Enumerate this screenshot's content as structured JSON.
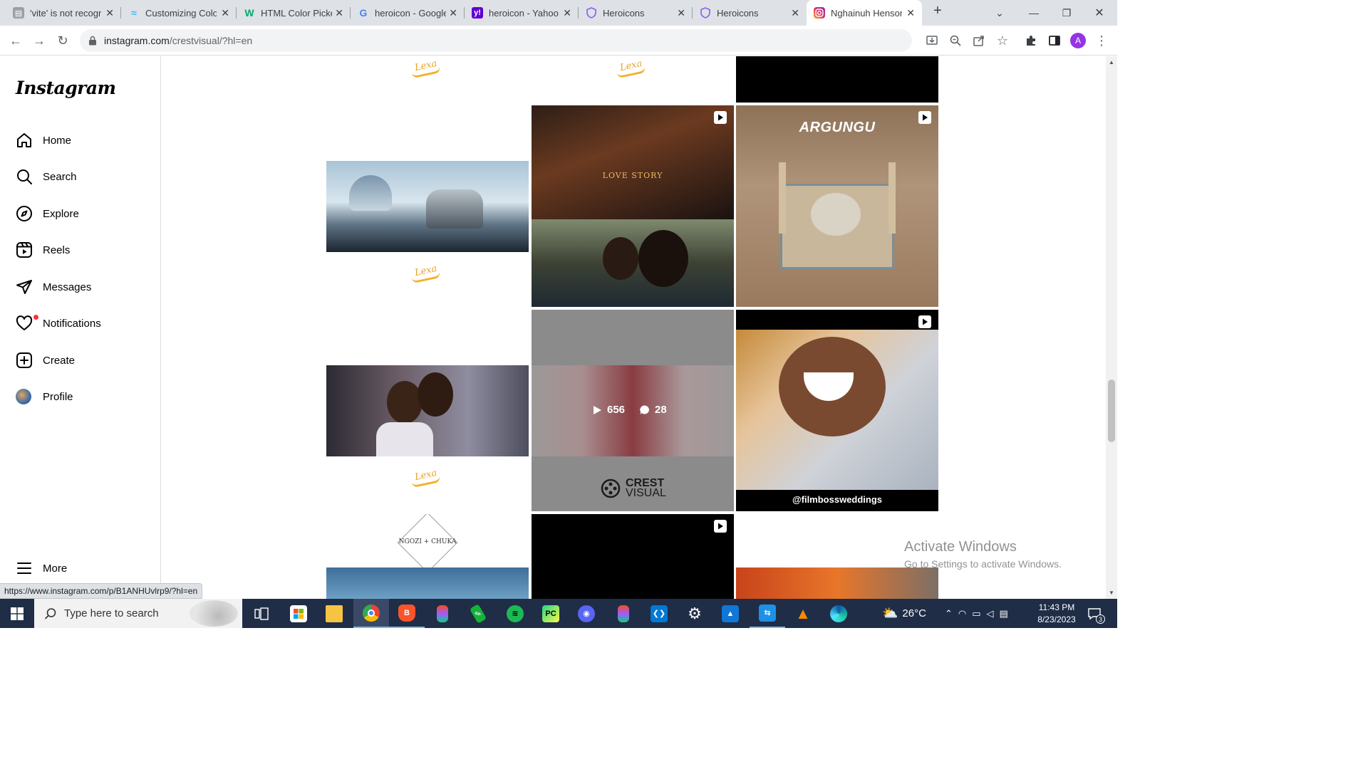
{
  "browser": {
    "tabs": [
      {
        "title": "'vite' is not recognized",
        "favicon": "page-icon",
        "color": "#5f6368"
      },
      {
        "title": "Customizing Colors",
        "favicon": "tailwind-icon",
        "color": "#38bdf8"
      },
      {
        "title": "HTML Color Picker",
        "favicon": "w3schools-icon",
        "color": "#04aa6d"
      },
      {
        "title": "heroicon - Google Search",
        "favicon": "google-icon",
        "color": "#4285f4"
      },
      {
        "title": "heroicon - Yahoo Search",
        "favicon": "yahoo-icon",
        "color": "#6001d2"
      },
      {
        "title": "Heroicons",
        "favicon": "heroicons-icon",
        "color": "#8b5cf6"
      },
      {
        "title": "Heroicons",
        "favicon": "heroicons-icon",
        "color": "#8b5cf6"
      },
      {
        "title": "Nghainuh Henson",
        "favicon": "instagram-icon",
        "color": "#e1306c"
      }
    ],
    "url_host": "instagram.com",
    "url_path": "/crestvisual/?hl=en",
    "profile_initial": "A",
    "status_url": "https://www.instagram.com/p/B1ANHUvlrp9/?hl=en"
  },
  "instagram": {
    "logo": "Instagram",
    "nav": {
      "home": "Home",
      "search": "Search",
      "explore": "Explore",
      "reels": "Reels",
      "messages": "Messages",
      "notifications": "Notifications",
      "create": "Create",
      "profile": "Profile",
      "more": "More"
    },
    "posts": {
      "logo_text": "Lexa Imagery",
      "love_story": "LOVE STORY",
      "argungu": "ARGUNGU",
      "hover_plays": "656",
      "hover_comments": "28",
      "crest_line1": "CREST",
      "crest_line2": "VISUAL",
      "filmboss": "@filmbossweddings",
      "ngozi_line": "NGOZI + CHUKA"
    }
  },
  "windows": {
    "activate_title": "Activate Windows",
    "activate_sub": "Go to Settings to activate Windows.",
    "search_placeholder": "Type here to search",
    "weather": "26°C",
    "time": "11:43 PM",
    "date": "8/23/2023",
    "notification_count": "3"
  }
}
